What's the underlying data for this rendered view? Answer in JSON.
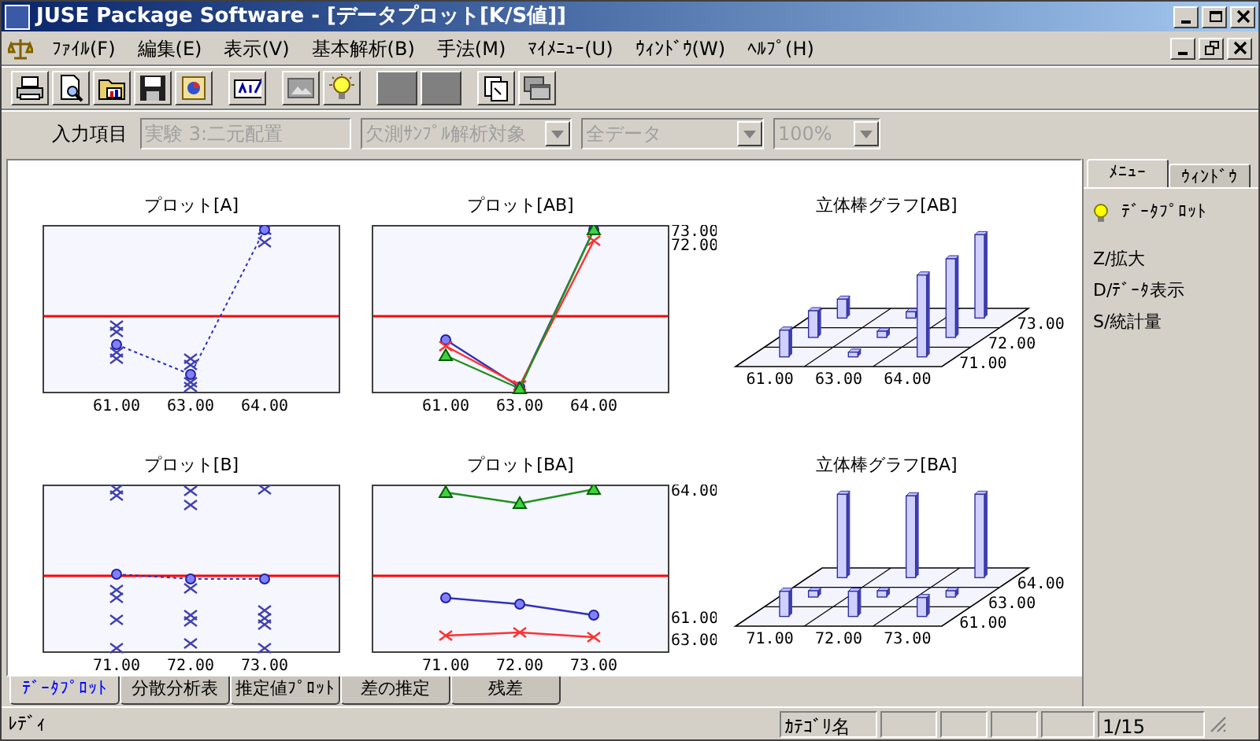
{
  "window": {
    "title": "JUSE Package Software - [データプロット[K/S値]]"
  },
  "menu": [
    "ﾌｧｲﾙ(F)",
    "編集(E)",
    "表示(V)",
    "基本解析(B)",
    "手法(M)",
    "ﾏｲﾒﾆｭｰ(U)",
    "ｳｨﾝﾄﾞｳ(W)",
    "ﾍﾙﾌﾟ(H)"
  ],
  "toolbar": [
    {
      "kind": "printer"
    },
    {
      "kind": "preview"
    },
    {
      "kind": "folder"
    },
    {
      "kind": "save"
    },
    {
      "kind": "chart"
    },
    {
      "kind": "text"
    },
    {
      "kind": "picture"
    },
    {
      "kind": "bulb"
    },
    {
      "kind": "blank"
    },
    {
      "kind": "blank"
    },
    {
      "kind": "copy"
    },
    {
      "kind": "windows"
    }
  ],
  "input_bar": {
    "label": "入力項目",
    "fields": [
      {
        "value": "実験 3:二元配置",
        "dropdown": false,
        "disabled": true
      },
      {
        "value": "欠測ｻﾝﾌﾟﾙ解析対象",
        "dropdown": true,
        "disabled": true
      },
      {
        "value": "全データ",
        "dropdown": true,
        "disabled": true
      },
      {
        "value": "100%",
        "dropdown": true,
        "disabled": true
      }
    ]
  },
  "charts": [
    {
      "kind": "dot_plot",
      "title": "プロット[A]",
      "x_labels": [
        "61.00",
        "63.00",
        "64.00"
      ]
    },
    {
      "kind": "line_plot",
      "title": "プロット[AB]",
      "x_labels": [
        "61.00",
        "63.00",
        "64.00"
      ],
      "series_labels": [
        "73.00",
        "72.00"
      ]
    },
    {
      "kind": "bar_3d",
      "title": "立体棒グラフ[AB]",
      "x_labels": [
        "61.00",
        "63.00",
        "64.00"
      ],
      "depth_labels": [
        "73.00",
        "72.00",
        "71.00"
      ]
    },
    {
      "kind": "dot_plot",
      "title": "プロット[B]",
      "x_labels": [
        "71.00",
        "72.00",
        "73.00"
      ]
    },
    {
      "kind": "line_plot",
      "title": "プロット[BA]",
      "x_labels": [
        "71.00",
        "72.00",
        "73.00"
      ],
      "series_labels": [
        "64.00",
        "61.00",
        "63.00"
      ]
    },
    {
      "kind": "bar_3d",
      "title": "立体棒グラフ[BA]",
      "x_labels": [
        "71.00",
        "72.00",
        "73.00"
      ],
      "depth_labels": [
        "64.00",
        "63.00",
        "61.00"
      ]
    }
  ],
  "bottom_tabs": [
    {
      "label": "ﾃﾞｰﾀﾌﾟﾛｯﾄ",
      "selected": true
    },
    {
      "label": "分散分析表",
      "selected": false
    },
    {
      "label": "推定値ﾌﾟﾛｯﾄ",
      "selected": false
    },
    {
      "label": "差の推定",
      "selected": false
    },
    {
      "label": "残差",
      "selected": false
    }
  ],
  "side_panel": {
    "tabs": [
      {
        "label": "ﾒﾆｭｰ",
        "selected": true
      },
      {
        "label": "ｳｨﾝﾄﾞｳ",
        "selected": false
      }
    ],
    "items": [
      {
        "label": "ﾃﾞｰﾀﾌﾟﾛｯﾄ",
        "kind": "bulb"
      },
      {
        "label": "Z/拡大",
        "kind": "plain"
      },
      {
        "label": "D/ﾃﾞｰﾀ表示",
        "kind": "plain"
      },
      {
        "label": "S/統計量",
        "kind": "plain"
      }
    ]
  },
  "status_bar": {
    "text": "ﾚﾃﾞｨ",
    "category": "ｶﾃｺﾞﾘ名",
    "page": "1/15"
  }
}
